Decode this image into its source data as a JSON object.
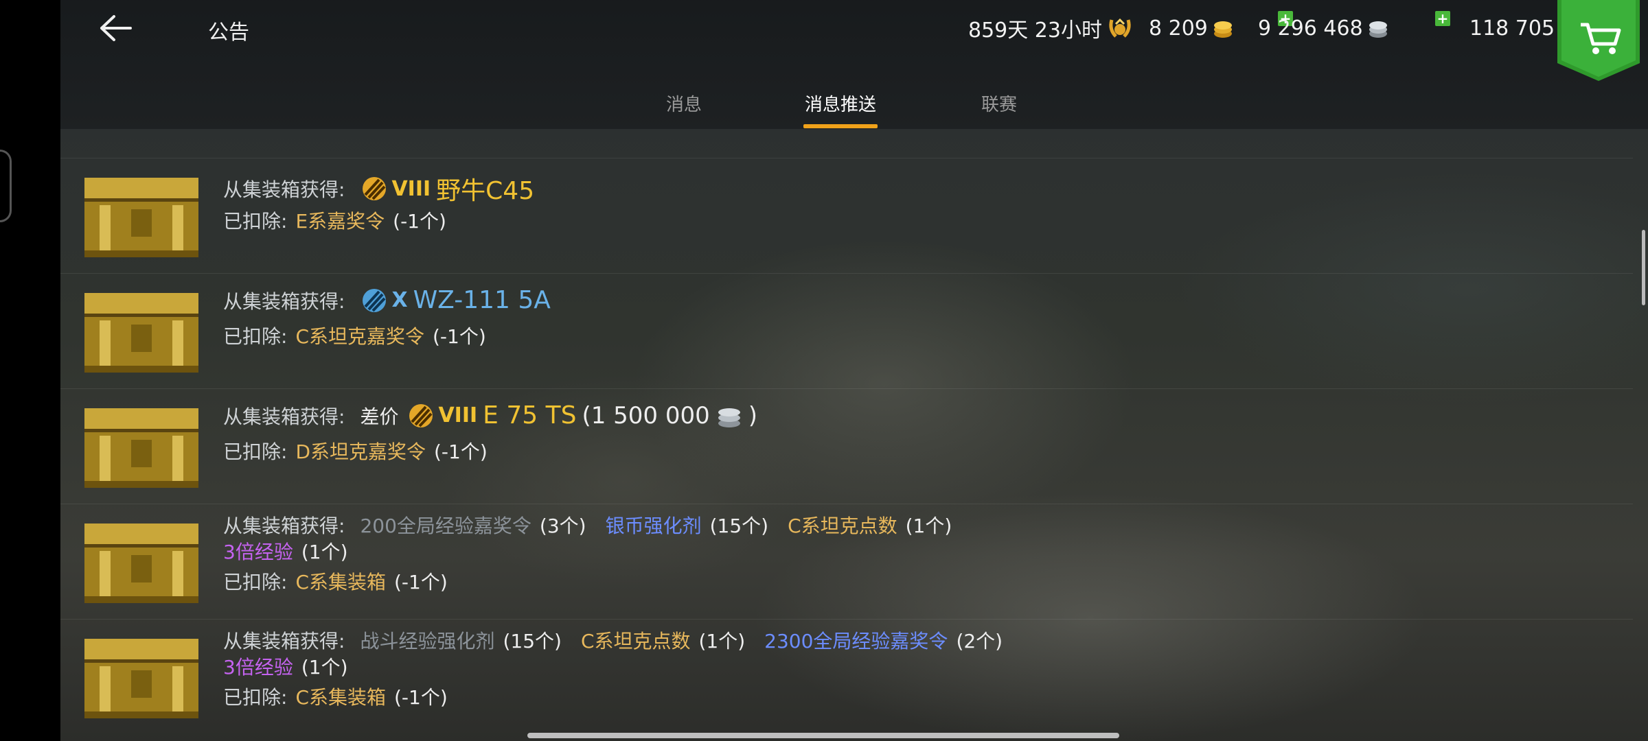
{
  "header": {
    "title": "公告",
    "premium_time": "859天 23小时",
    "gold": "8 209",
    "credits": "9 296 468",
    "free_xp": "118 705"
  },
  "tabs": [
    {
      "label": "消息",
      "active": false
    },
    {
      "label": "消息推送",
      "active": true
    },
    {
      "label": "联赛",
      "active": false
    }
  ],
  "messages": [
    {
      "obtained_label": "从集装箱获得:",
      "tier": "VIII",
      "vehicle": "野牛C45",
      "deducted_label": "已扣除:",
      "deducted_item": "E系嘉奖令",
      "deducted_qty": "(-1个)"
    },
    {
      "obtained_label": "从集装箱获得:",
      "tier": "X",
      "vehicle": "WZ-111 5A",
      "deducted_label": "已扣除:",
      "deducted_item": "C系坦克嘉奖令",
      "deducted_qty": "(-1个)"
    },
    {
      "obtained_label": "从集装箱获得:",
      "diff_label": "差价",
      "tier": "VIII",
      "vehicle": "E 75 TS",
      "comp_open": "(1 500 000",
      "comp_close": ")",
      "deducted_label": "已扣除:",
      "deducted_item": "D系坦克嘉奖令",
      "deducted_qty": "(-1个)"
    },
    {
      "obtained_label": "从集装箱获得:",
      "r1_name": "200全局经验嘉奖令",
      "r1_qty": "(3个)",
      "r2_name": "银币强化剂",
      "r2_qty": "(15个)",
      "r3_name": "C系坦克点数",
      "r3_qty": "(1个)",
      "r4_name": "3倍经验",
      "r4_qty": "(1个)",
      "deducted_label": "已扣除:",
      "deducted_item": "C系集装箱",
      "deducted_qty": "(-1个)"
    },
    {
      "obtained_label": "从集装箱获得:",
      "r1_name": "战斗经验强化剂",
      "r1_qty": "(15个)",
      "r2_name": "C系坦克点数",
      "r2_qty": "(1个)",
      "r3_name": "2300全局经验嘉奖令",
      "r3_qty": "(2个)",
      "r4_name": "3倍经验",
      "r4_qty": "(1个)",
      "deducted_label": "已扣除:",
      "deducted_item": "C系集装箱",
      "deducted_qty": "(-1个)"
    }
  ],
  "colors": {
    "accent_tab": "#f0a21a",
    "gold_text": "#e8b85c",
    "blue_text": "#6c8dff",
    "purple_text": "#c563f0",
    "premium_tank": "#f1c232",
    "tech_tree_tank": "#6ab2e8",
    "cart_green": "#2f9a2c"
  },
  "icons": [
    "back-arrow-icon",
    "premium-laurel-icon",
    "gold-coins-icon",
    "silver-coins-icon",
    "star-icon",
    "plus-icon",
    "cart-icon",
    "crate-icon",
    "premium-tank-badge-icon",
    "tech-tree-tank-badge-icon",
    "silver-coin-stack-icon"
  ]
}
